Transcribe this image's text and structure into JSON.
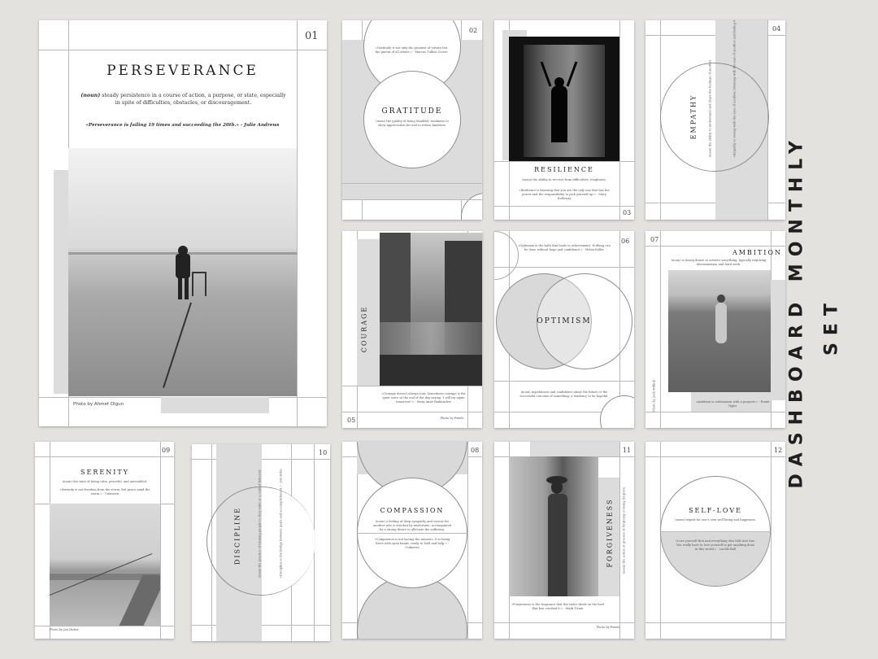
{
  "brand": {
    "line1": "DASHBOARD MONTHLY",
    "line2": "SET"
  },
  "main": {
    "number": "01",
    "title": "PERSEVERANCE",
    "pos": "(noun)",
    "definition": " steady persistence in a course of action, a purpose, or state, especially in spite of difficulties, obstacles, or discouragement.",
    "quote": "«Perseverance is failing 19 times and succeeding the 20th.» - Julie Andrews",
    "credit": "Photo by Ahmet Olgun"
  },
  "pages": [
    {
      "number": "02",
      "title": "GRATITUDE"
    },
    {
      "number": "03",
      "title": "RESILIENCE"
    },
    {
      "number": "04",
      "title": "EMPATHY"
    },
    {
      "number": "05",
      "title": "COURAGE"
    },
    {
      "number": "06",
      "title": "OPTIMISM"
    },
    {
      "number": "07",
      "title": "AMBITION"
    },
    {
      "number": "09",
      "title": "SERENITY"
    },
    {
      "number": "10",
      "title": "DISCIPLINE"
    },
    {
      "number": "08",
      "title": "COMPASSION"
    },
    {
      "number": "11",
      "title": "FORGIVENESS"
    },
    {
      "number": "12",
      "title": "SELF-LOVE"
    }
  ],
  "colors": {
    "background": "#e3e2df",
    "panel": "#dcdcdc",
    "ink": "#222222"
  }
}
